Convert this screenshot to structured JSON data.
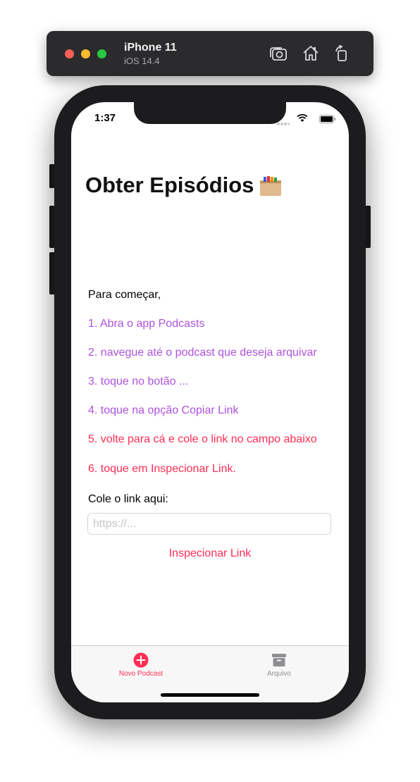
{
  "simulator": {
    "device_name": "iPhone 11",
    "os_version": "iOS 14.4",
    "buttons": [
      "screenshot-icon",
      "home-icon",
      "rotate-icon"
    ]
  },
  "status_bar": {
    "time": "1:37"
  },
  "page": {
    "title": "Obter Episódios",
    "title_icon": "archive-box-icon"
  },
  "instructions": {
    "intro": "Para começar,",
    "steps": [
      {
        "text": "1. Abra o app Podcasts",
        "color": "#af52de"
      },
      {
        "text": "2. navegue até o podcast que deseja arquivar",
        "color": "#af52de"
      },
      {
        "text": "3. toque no botão ...",
        "color": "#af52de"
      },
      {
        "text": "4. toque na opção Copiar Link",
        "color": "#af52de"
      },
      {
        "text": "5. volte para cá e cole o link no campo abaixo",
        "color": "#ff2d55"
      },
      {
        "text": "6. toque em Inspecionar Link.",
        "color": "#ff2d55"
      }
    ]
  },
  "link_form": {
    "label": "Cole o link aqui:",
    "placeholder": "https://...",
    "value": "",
    "button_label": "Inspecionar Link"
  },
  "tab_bar": {
    "tabs": [
      {
        "label": "Novo Podcast",
        "icon": "plus-circle-icon",
        "selected": true
      },
      {
        "label": "Arquivo",
        "icon": "archive-box-icon",
        "selected": false
      }
    ]
  },
  "colors": {
    "accent": "#ff2d55",
    "purple": "#af52de"
  }
}
